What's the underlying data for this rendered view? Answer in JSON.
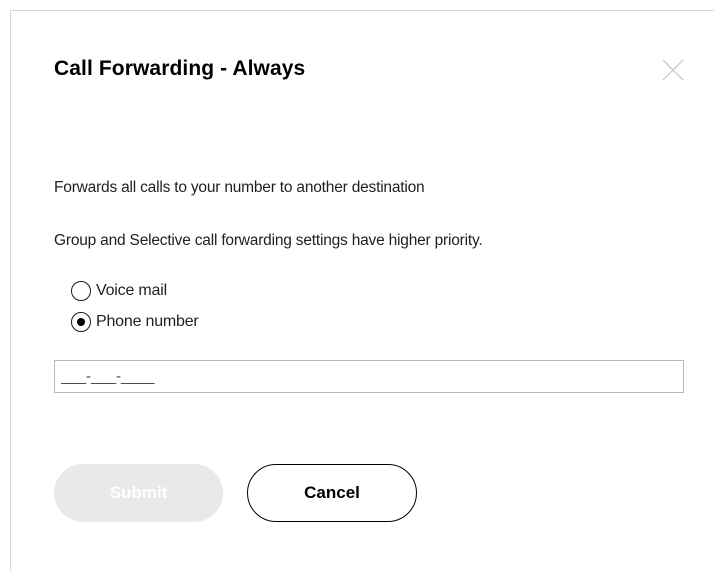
{
  "dialog": {
    "title": "Call Forwarding - Always",
    "close_icon": "close-icon",
    "description_1": "Forwards all calls to your number to another destination",
    "description_2": "Group and Selective call forwarding settings have higher priority."
  },
  "options": [
    {
      "label": "Voice mail",
      "selected": false
    },
    {
      "label": "Phone number",
      "selected": true
    }
  ],
  "phone_input": {
    "placeholder": "___-___-____",
    "value": ""
  },
  "buttons": {
    "submit_label": "Submit",
    "submit_disabled": true,
    "cancel_label": "Cancel"
  },
  "colors": {
    "border": "#d8d8d8",
    "submit_disabled_bg": "#e9e9e9",
    "text": "#1a1a1a"
  }
}
